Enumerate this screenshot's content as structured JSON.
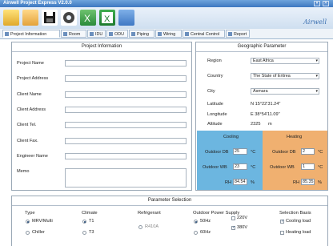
{
  "window": {
    "title": "Airwell Project Express V2.0.0"
  },
  "brand": {
    "logo_text": "Airwell"
  },
  "tabs": [
    "Project Information",
    "Room",
    "IDU",
    "ODU",
    "Piping",
    "Wiring",
    "Central Control",
    "Report"
  ],
  "project": {
    "header": "Project Information",
    "fields": [
      "Project Name",
      "Project Address",
      "Client Name",
      "Client Address",
      "Client Tel.",
      "Client Fax.",
      "Engineer Name",
      "Memo"
    ]
  },
  "geo": {
    "header": "Geographic Parameter",
    "region_label": "Region",
    "region": "East Africa",
    "country_label": "Country",
    "country": "The State of Eritrea",
    "city_label": "City",
    "city": "Asmara",
    "latitude_label": "Latitude",
    "latitude": "N 15°22'31.24\"",
    "longitude_label": "Longitude",
    "longitude": "E 38°54'11.09\"",
    "altitude_label": "Altitude",
    "altitude": "2325",
    "altitude_unit": "m"
  },
  "cooling": {
    "header": "Cooling",
    "db_label": "Outdoor DB",
    "db": "25",
    "db_unit": "°C",
    "wb_label": "Outdoor WB",
    "wb": "23",
    "wb_unit": "°C",
    "rh_label": "RH",
    "rh": "84.54",
    "rh_unit": "%",
    "color": "#6cb6e0"
  },
  "heating": {
    "header": "Heating",
    "db_label": "Outdoor DB",
    "db": "2",
    "db_unit": "°C",
    "wb_label": "Outdoor WB",
    "wb": "1",
    "wb_unit": "°C",
    "rh_label": "RH",
    "rh": "85.35",
    "rh_unit": "%",
    "color": "#f0b070"
  },
  "params": {
    "header": "Parameter Selection",
    "type_label": "Type",
    "type_opt1": "MRV/Multi",
    "type_opt2": "Chiller",
    "climate_label": "Climate",
    "climate_opt1": "T1",
    "climate_opt2": "T3",
    "refrigerant_label": "Refrigerant",
    "refrigerant_opt1": "R410A",
    "power_label": "Outdoor Power Supply",
    "power_hz1": "50Hz",
    "power_hz2": "60Hz",
    "power_v1": "220V",
    "power_v2": "380V",
    "basis_label": "Selection Basis",
    "basis_opt1": "Cooling load",
    "basis_opt2": "Heating load"
  }
}
